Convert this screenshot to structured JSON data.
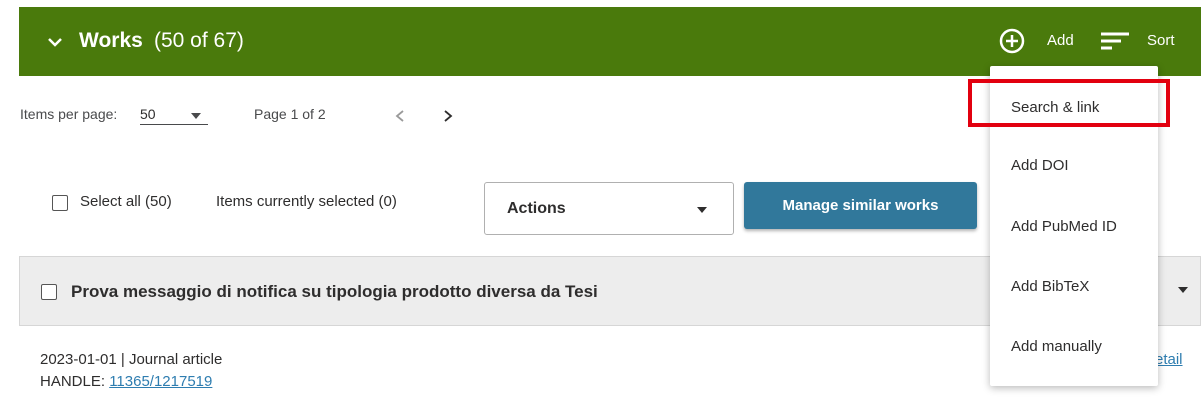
{
  "header": {
    "title": "Works",
    "count": "(50 of 67)",
    "add_label": "Add",
    "sort_label": "Sort",
    "icons": {
      "collapse": "chevron-down-icon",
      "add": "plus-circle-icon",
      "sort": "sort-lines-icon"
    }
  },
  "pager": {
    "items_per_page_label": "Items per page:",
    "items_per_page_value": "50",
    "page_info": "Page 1 of 2"
  },
  "toolbar": {
    "select_all": "Select all (50)",
    "items_selected": "Items currently selected (0)",
    "actions_label": "Actions",
    "manage_label": "Manage similar works"
  },
  "work": {
    "title": "Prova messaggio di notifica su tipologia prodotto diversa da Tesi",
    "meta": "2023-01-01 | Journal article",
    "handle_label": "HANDLE: ",
    "handle_value": "11365/1217519",
    "detail_link": "etail"
  },
  "add_menu": {
    "items": [
      "Search & link",
      "Add DOI",
      "Add PubMed ID",
      "Add BibTeX",
      "Add manually"
    ],
    "highlighted": "Search & link"
  },
  "colors": {
    "header_bg": "#4a7a0c",
    "manage_button": "#31789b",
    "link": "#2e7db0",
    "highlight_box": "#e2000f"
  }
}
